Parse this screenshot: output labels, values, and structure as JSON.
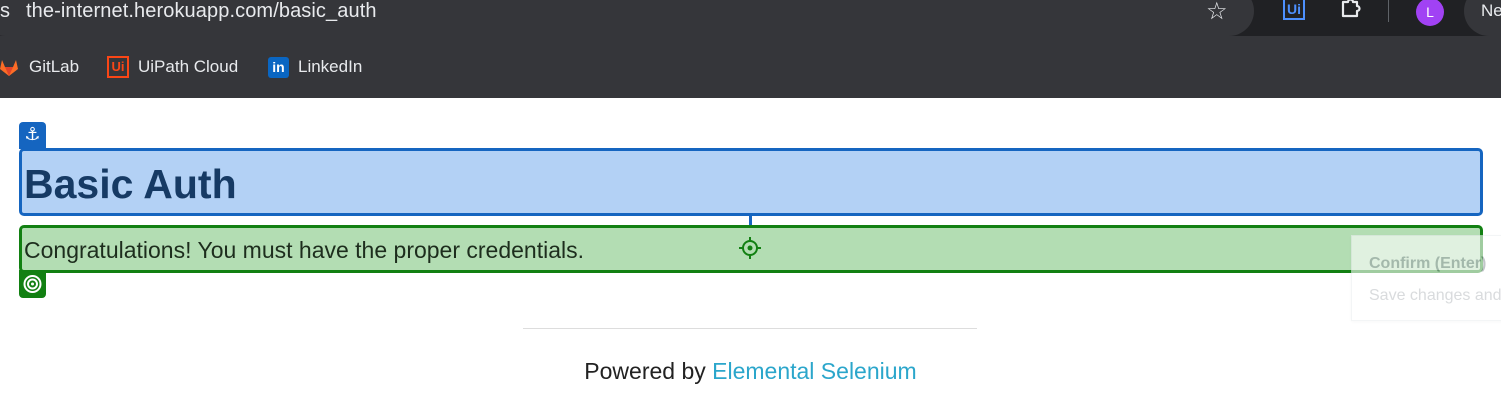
{
  "browser": {
    "url": "the-internet.herokuapp.com/basic_auth",
    "url_prefix_fragment": "s",
    "avatar_letter": "L",
    "new_chip_label": "Ne",
    "extension_label": "Ui",
    "icons": [
      "bookmark-star-icon",
      "uipath-extension-icon",
      "extensions-puzzle-icon",
      "profile-avatar"
    ]
  },
  "bookmarks": [
    {
      "label": "GitLab",
      "icon": "gitlab-icon"
    },
    {
      "label": "UiPath Cloud",
      "icon": "uipath-icon",
      "icon_text": "Ui"
    },
    {
      "label": "LinkedIn",
      "icon": "linkedin-icon",
      "icon_text": "in"
    }
  ],
  "page": {
    "heading": "Basic Auth",
    "message": "Congratulations! You must have the proper credentials.",
    "footer_prefix": "Powered by ",
    "footer_link": "Elemental Selenium"
  },
  "overlay": {
    "confirm_title": "Confirm (Enter)",
    "confirm_subtitle": "Save changes and",
    "anchor_color": "#1565c0",
    "target_color": "#128012",
    "anchor_fill": "#b3d1f5",
    "target_fill": "#b3ddb3"
  }
}
